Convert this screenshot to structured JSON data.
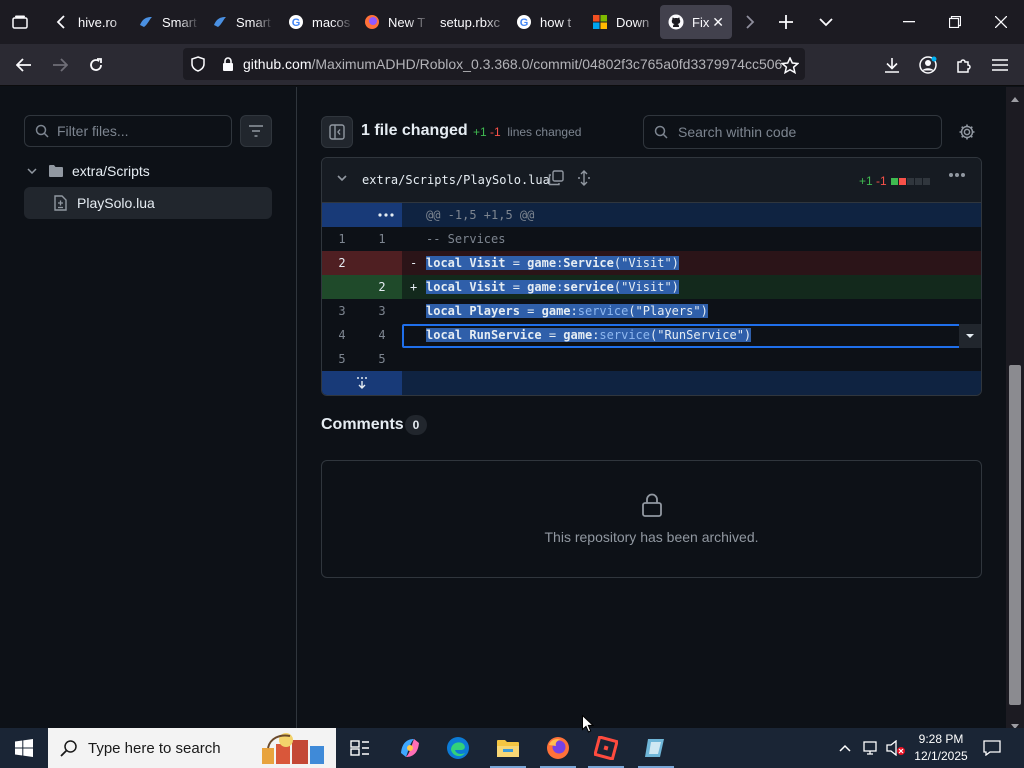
{
  "browser": {
    "tabs": [
      {
        "title": "hive.ro",
        "active": false
      },
      {
        "title": "Smart",
        "active": false
      },
      {
        "title": "Smart",
        "active": false
      },
      {
        "title": "macos",
        "active": false
      },
      {
        "title": "New T",
        "active": false
      },
      {
        "title": "setup.rbxc",
        "active": false
      },
      {
        "title": "how t",
        "active": false
      },
      {
        "title": "Down",
        "active": false
      },
      {
        "title": "Fix",
        "active": true
      }
    ],
    "url": {
      "host": "github.com",
      "path": "/MaximumADHD/Roblox_0.3.368.0/commit/04802f3c765a0fd3379974cc506"
    }
  },
  "sidebar": {
    "filter_placeholder": "Filter files...",
    "tree": {
      "directory": "extra/Scripts",
      "file": "PlaySolo.lua"
    }
  },
  "diff_summary": {
    "files_changed": "1 file changed",
    "additions": "+1",
    "deletions": "-1",
    "lines_label": "lines changed",
    "search_placeholder": "Search within code"
  },
  "diff_file": {
    "path": "extra/Scripts/PlaySolo.lua",
    "additions": "+1",
    "deletions": "-1",
    "hunk": "@@ -1,5 +1,5 @@",
    "lines": [
      {
        "type": "context",
        "old": "1",
        "new": "1",
        "marker": "",
        "parts": [
          [
            "c",
            "-- Services"
          ]
        ]
      },
      {
        "type": "del",
        "old": "2",
        "new": "",
        "marker": "-",
        "parts": [
          [
            "k",
            "local"
          ],
          [
            "t",
            " Visit "
          ],
          [
            "o",
            "="
          ],
          [
            "t",
            " game"
          ],
          [
            "o",
            ":"
          ],
          [
            "t",
            "Service"
          ],
          [
            "s",
            "(\"Visit\")"
          ]
        ]
      },
      {
        "type": "add",
        "old": "",
        "new": "2",
        "marker": "+",
        "parts": [
          [
            "k",
            "local"
          ],
          [
            "t",
            " Visit "
          ],
          [
            "o",
            "="
          ],
          [
            "t",
            " game"
          ],
          [
            "o",
            ":"
          ],
          [
            "t",
            "service"
          ],
          [
            "s",
            "(\"Visit\")"
          ]
        ]
      },
      {
        "type": "context",
        "old": "3",
        "new": "3",
        "marker": "",
        "parts": [
          [
            "k",
            "local"
          ],
          [
            "t",
            " Players "
          ],
          [
            "o",
            "="
          ],
          [
            "t",
            " game"
          ],
          [
            "o",
            ":"
          ],
          [
            "f",
            "service"
          ],
          [
            "s",
            "(\"Players\")"
          ]
        ]
      },
      {
        "type": "context",
        "old": "4",
        "new": "4",
        "marker": "",
        "parts": [
          [
            "k",
            "local"
          ],
          [
            "t",
            " RunService "
          ],
          [
            "o",
            "="
          ],
          [
            "t",
            " game"
          ],
          [
            "o",
            ":"
          ],
          [
            "f",
            "service"
          ],
          [
            "s",
            "(\"RunService\")"
          ]
        ]
      },
      {
        "type": "context",
        "old": "5",
        "new": "5",
        "marker": "",
        "parts": []
      }
    ]
  },
  "comments": {
    "title": "Comments",
    "count": "0",
    "archived_message": "This repository has been archived."
  },
  "taskbar": {
    "search_placeholder": "Type here to search",
    "time": "9:28 PM",
    "date": "12/1/2025"
  },
  "colors": {
    "accent_blue": "#1f6feb",
    "add_green": "#3fb950",
    "del_red": "#f85149",
    "selection": "#2f5faa"
  }
}
